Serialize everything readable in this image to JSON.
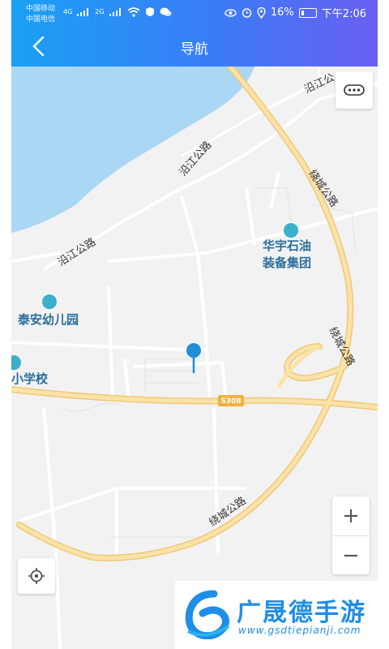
{
  "status_bar": {
    "carrier1": "中国移动",
    "carrier2": "中国电信",
    "net1": "4G",
    "net2": "2G",
    "battery": "16%",
    "time": "下午2:06"
  },
  "header": {
    "title": "导航"
  },
  "map": {
    "pois": [
      "华宇石油",
      "装备集团",
      "泰安幼儿园",
      "小学校"
    ],
    "roads": [
      "沿江公路",
      "沿江公路",
      "沿江公",
      "沿江公路",
      "绕城公路",
      "绕城公路",
      "绕城公路",
      "S308"
    ]
  },
  "controls": {
    "zoom_in": "+",
    "zoom_out": "−"
  },
  "brand": {
    "name": "广晟德手游",
    "url": "www.gsdtiepianji.com"
  },
  "colors": {
    "accent": "#1aa1f4",
    "accent_end": "#6a5ff2",
    "marker": "#1e8fd8",
    "water": "#a9d7f4",
    "highway": "#f7d98b"
  }
}
